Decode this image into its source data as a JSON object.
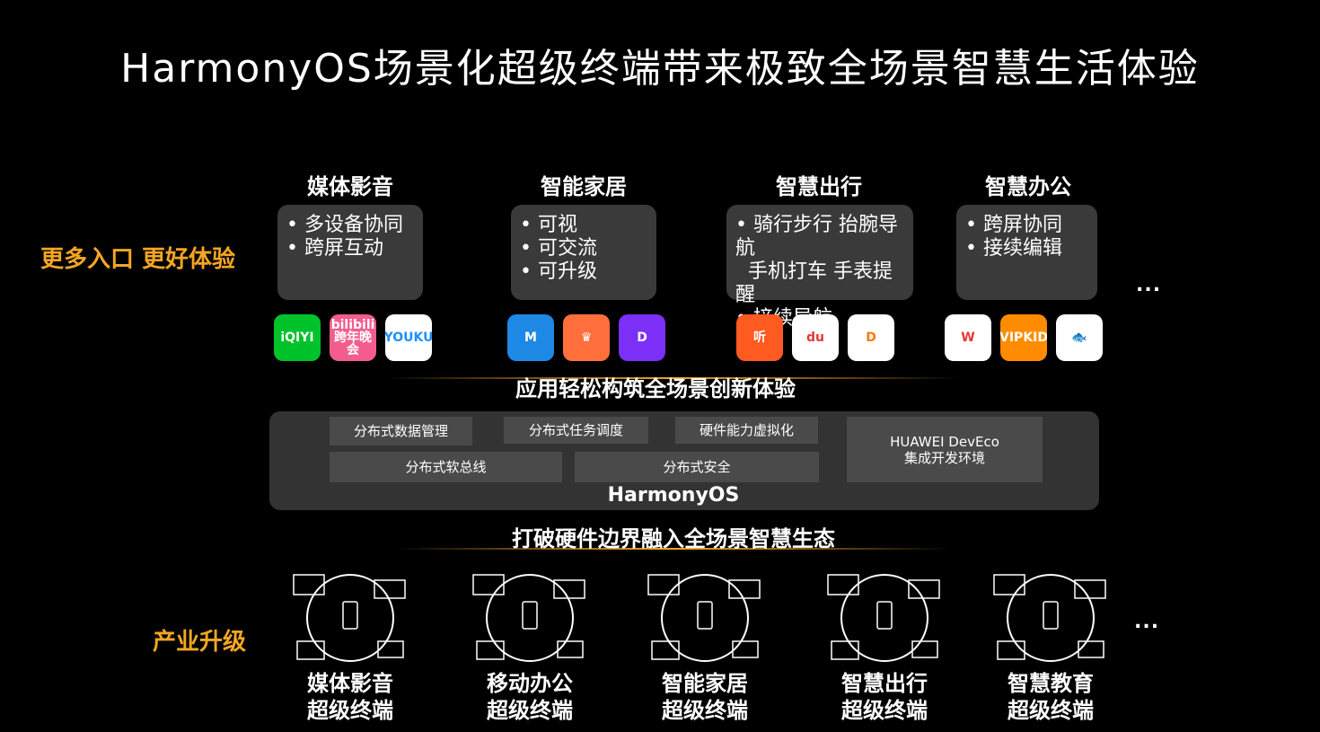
{
  "title": "HarmonyOS场景化超级终端带来极致全场景智慧生活体验",
  "top_side_label": "更多入口 更好体验",
  "bottom_side_label": "产业升级",
  "categories": [
    {
      "title": "媒体影音",
      "items": [
        "多设备协同",
        "跨屏互动"
      ],
      "apps": [
        {
          "name": "iqiyi-icon",
          "text": "iQIYI",
          "bg": "#00c22b",
          "fg": "#fff"
        },
        {
          "name": "bilibili-icon",
          "text": "bilibili\n跨年晚会",
          "bg": "#f25d8e",
          "fg": "#fff"
        },
        {
          "name": "youku-icon",
          "text": "YOUKU",
          "bg": "#ffffff",
          "fg": "#1e90ff"
        }
      ]
    },
    {
      "title": "智能家居",
      "items": [
        "可视",
        "可交流",
        "可升级"
      ],
      "apps": [
        {
          "name": "smart-home-app-icon",
          "text": "M",
          "bg": "#1e88e5",
          "fg": "#fff"
        },
        {
          "name": "chef-hat-app-icon",
          "text": "♛",
          "bg": "#ff6f3c",
          "fg": "#fff"
        },
        {
          "name": "purple-app-icon",
          "text": "D",
          "bg": "#7b2ff7",
          "fg": "#fff"
        }
      ]
    },
    {
      "title": "智慧出行",
      "items": [
        "骑行步行 抬腕导航",
        "手机打车 手表提醒",
        "接续导航"
      ],
      "apps": [
        {
          "name": "ting-app-icon",
          "text": "听",
          "bg": "#ff5a1f",
          "fg": "#fff"
        },
        {
          "name": "baidu-map-icon",
          "text": "du",
          "bg": "#ffffff",
          "fg": "#e53935"
        },
        {
          "name": "didi-icon",
          "text": "D",
          "bg": "#ffffff",
          "fg": "#ff7a00"
        }
      ]
    },
    {
      "title": "智慧办公",
      "items": [
        "跨屏协同",
        "接续编辑"
      ],
      "apps": [
        {
          "name": "wps-icon",
          "text": "W",
          "bg": "#ffffff",
          "fg": "#e53935"
        },
        {
          "name": "vipkid-icon",
          "text": "VIPKID",
          "bg": "#ff8c00",
          "fg": "#fff"
        },
        {
          "name": "fish-app-icon",
          "text": "🐟",
          "bg": "#ffffff",
          "fg": "#2e7d32"
        }
      ]
    }
  ],
  "ellipsis": "...",
  "apps_layer_label": "应用轻松构筑全场景创新体验",
  "platform": {
    "modules": [
      "分布式数据管理",
      "分布式任务调度",
      "硬件能力虚拟化",
      "分布式软总线",
      "分布式安全"
    ],
    "deveco_line1": "HUAWEI DevEco",
    "deveco_line2": "集成开发环境",
    "name": "HarmonyOS"
  },
  "ecosystem_label": "打破硬件边界融入全场景智慧生态",
  "devices": [
    {
      "line1": "媒体影音",
      "line2": "超级终端"
    },
    {
      "line1": "移动办公",
      "line2": "超级终端"
    },
    {
      "line1": "智能家居",
      "line2": "超级终端"
    },
    {
      "line1": "智慧出行",
      "line2": "超级终端"
    },
    {
      "line1": "智慧教育",
      "line2": "超级终端"
    }
  ],
  "colors": {
    "accent": "#f5a623",
    "card": "#3a3a3a",
    "platform": "#333333",
    "module": "#4a4a4a"
  }
}
